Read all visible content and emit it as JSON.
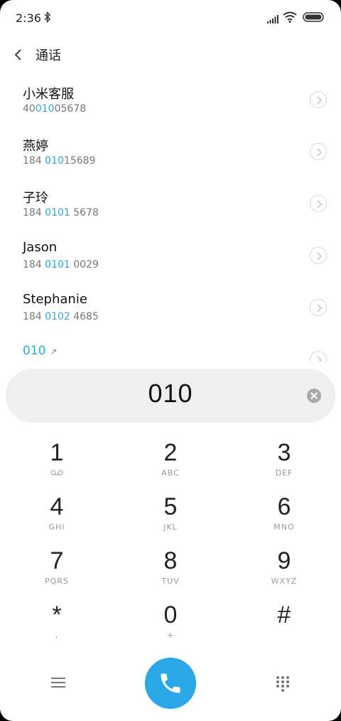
{
  "status_bar": {
    "time": "2:36",
    "icons": [
      "bluetooth-icon",
      "signal-icon",
      "wifi-icon",
      "battery-icon"
    ]
  },
  "header": {
    "title": "通话",
    "back_icon": "chevron-left-icon"
  },
  "results": [
    {
      "name": "小米客服",
      "num_pre": "40",
      "num_hl": "010",
      "num_post": "05678"
    },
    {
      "name": "燕婷",
      "num_pre": "184 ",
      "num_hl": "010",
      "num_post": "15689"
    },
    {
      "name": "子玲",
      "num_pre": "184 ",
      "num_hl": "0101",
      "num_post": " 5678"
    },
    {
      "name": "Jason",
      "num_pre": "184 ",
      "num_hl": "0101",
      "num_post": " 0029"
    },
    {
      "name": "Stephanie",
      "num_pre": "184 ",
      "num_hl": "0102",
      "num_post": " 4685"
    },
    {
      "name": "010",
      "arrow": "↗"
    }
  ],
  "dial_input": {
    "value": "010"
  },
  "keypad": [
    {
      "digit": "1",
      "letters": ""
    },
    {
      "digit": "2",
      "letters": "ABC"
    },
    {
      "digit": "3",
      "letters": "DEF"
    },
    {
      "digit": "4",
      "letters": "GHI"
    },
    {
      "digit": "5",
      "letters": "JKL"
    },
    {
      "digit": "6",
      "letters": "MNO"
    },
    {
      "digit": "7",
      "letters": "PQRS"
    },
    {
      "digit": "8",
      "letters": "TUV"
    },
    {
      "digit": "9",
      "letters": "WXYZ"
    },
    {
      "digit": "*",
      "letters": ","
    },
    {
      "digit": "0",
      "letters": "+"
    },
    {
      "digit": "#",
      "letters": ""
    }
  ],
  "colors": {
    "accent": "#2aa7e3",
    "call_button": "#29a8e8",
    "pill_bg": "#efefef"
  }
}
